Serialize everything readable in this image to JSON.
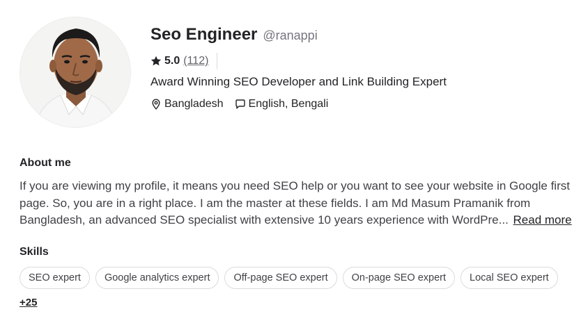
{
  "profile": {
    "display_name": "Seo Engineer",
    "username": "@ranappi",
    "rating": "5.0",
    "review_count": "(112)",
    "tagline": "Award Winning SEO Developer and Link Building Expert",
    "location": "Bangladesh",
    "languages": "English, Bengali"
  },
  "about": {
    "title": "About me",
    "text": "If you are viewing my profile, it means you need SEO help or you want to see your website in Google first page. So, you are in a right place. I am the master at these fields. I am Md Masum Pramanik from Bangladesh, an advanced SEO specialist with extensive 10 years experience with WordPre...",
    "read_more": "Read more"
  },
  "skills": {
    "title": "Skills",
    "items": [
      {
        "label": "SEO expert"
      },
      {
        "label": "Google analytics expert"
      },
      {
        "label": "Off-page SEO expert"
      },
      {
        "label": "On-page SEO expert"
      },
      {
        "label": "Local SEO expert"
      }
    ],
    "more": "+25"
  },
  "icons": {
    "rating": "star-icon",
    "location": "map-pin-icon",
    "languages": "chat-bubble-icon"
  },
  "colors": {
    "text_primary": "#222325",
    "text_secondary": "#74767e",
    "chip_border": "#dadbdd"
  }
}
